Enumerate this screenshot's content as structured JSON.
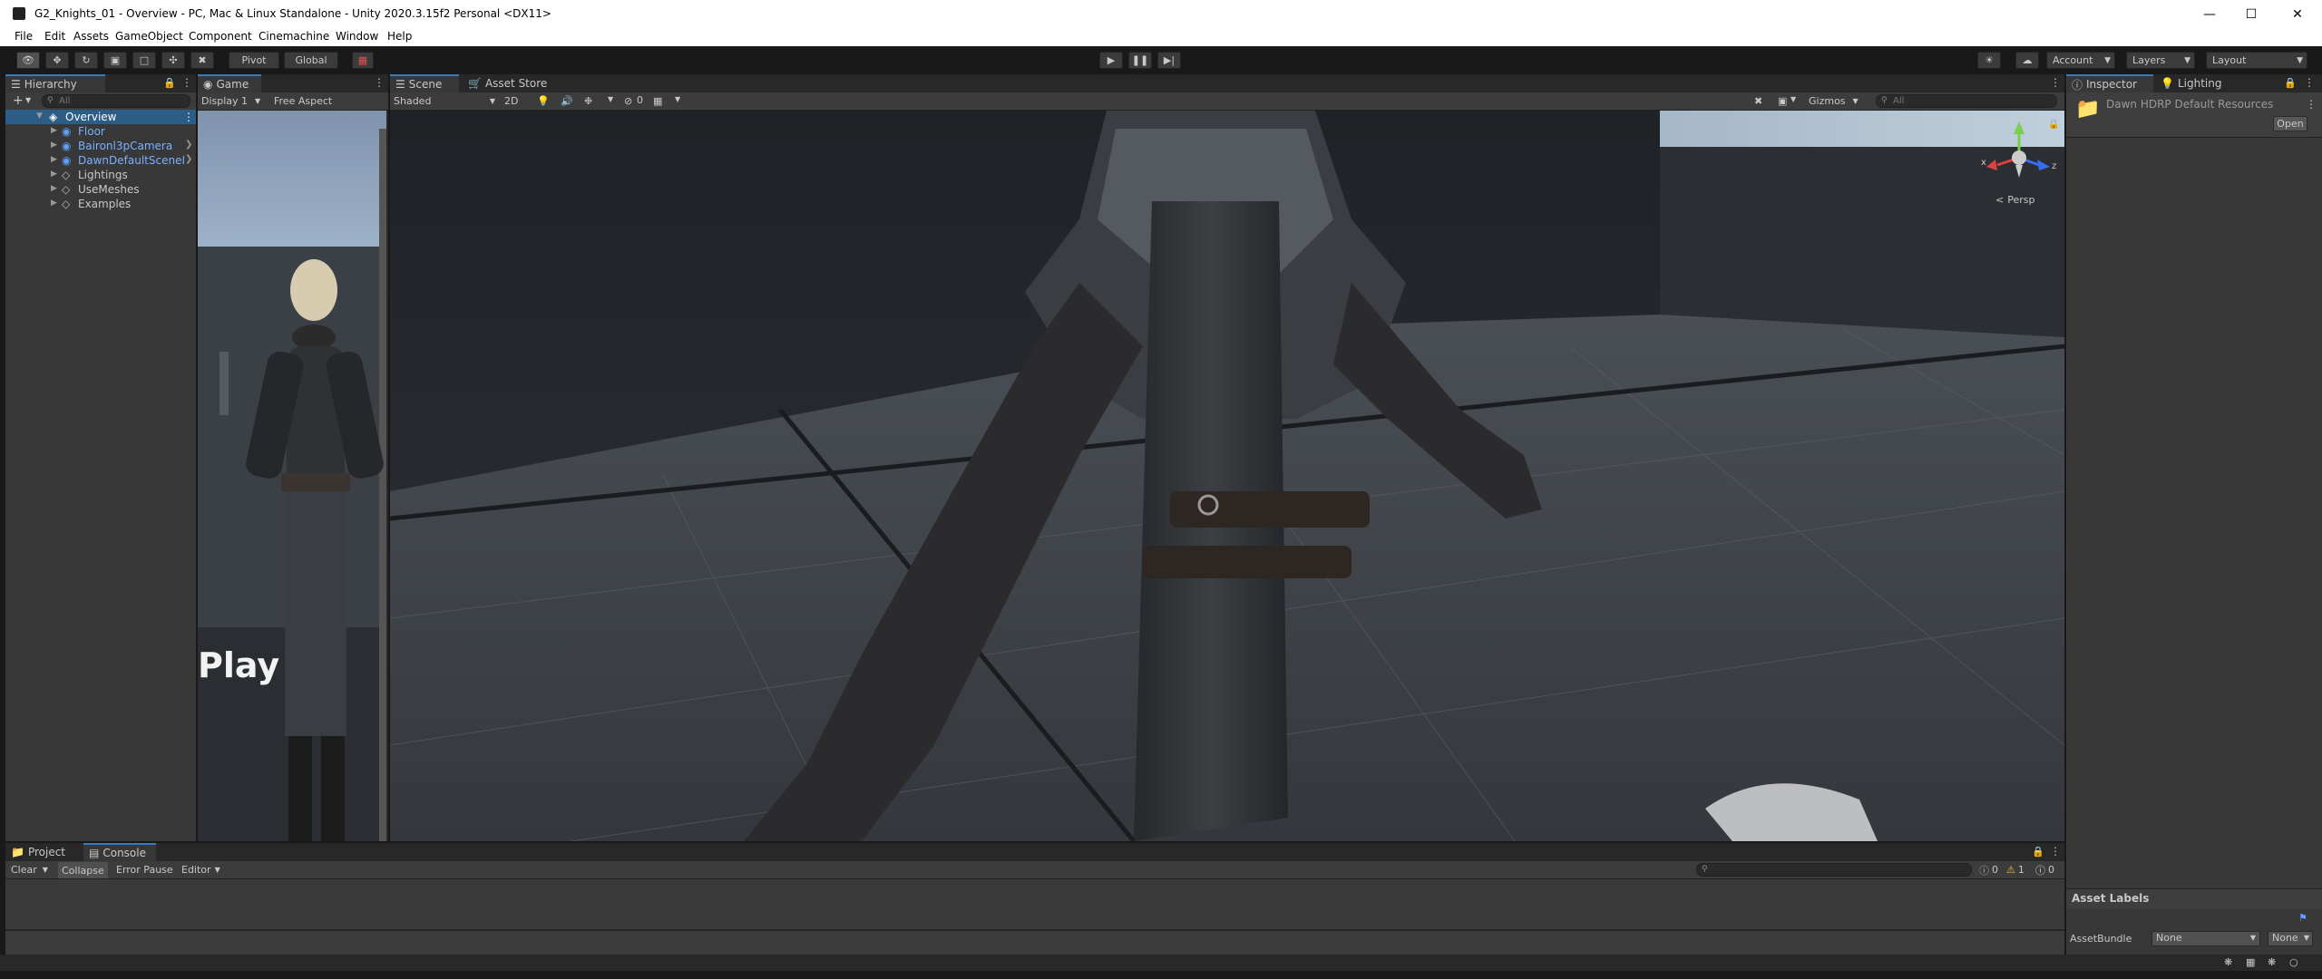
{
  "window": {
    "title": "G2_Knights_01 - Overview - PC, Mac & Linux Standalone - Unity 2020.3.15f2 Personal <DX11>",
    "controls": [
      "minimize-icon",
      "maximize-icon",
      "close-icon"
    ]
  },
  "menu": {
    "items": [
      "File",
      "Edit",
      "Assets",
      "GameObject",
      "Component",
      "Cinemachine",
      "Window",
      "Help"
    ]
  },
  "toolbar": {
    "pivot_label": "Pivot",
    "global_label": "Global",
    "account_label": "Account",
    "layers_label": "Layers",
    "layout_label": "Layout"
  },
  "hierarchy": {
    "tab_label": "Hierarchy",
    "add_label": "+",
    "search_placeholder": "All",
    "items": [
      {
        "label": "Overview"
      },
      {
        "label": "Floor"
      },
      {
        "label": "Baironl3pCamera"
      },
      {
        "label": "DawnDefaultSceneI"
      },
      {
        "label": "Lightings"
      },
      {
        "label": "UseMeshes"
      },
      {
        "label": "Examples"
      }
    ]
  },
  "game": {
    "tab_label": "Game",
    "display_label": "Display 1",
    "aspect_label": "Free Aspect",
    "overlay_text": "Play"
  },
  "scene": {
    "tabs": [
      "Scene",
      "Asset Store"
    ],
    "shading_label": "Shaded",
    "mode_2d_label": "2D",
    "hidden_count": "0",
    "gizmos_label": "Gizmos",
    "search_placeholder": "All",
    "persp_label": "Persp",
    "axis": {
      "x": "x",
      "y": "y",
      "z": "z"
    }
  },
  "inspector": {
    "tabs": [
      "Inspector",
      "Lighting"
    ],
    "asset_name": "Dawn HDRP Default Resources",
    "open_label": "Open",
    "asset_labels_header": "Asset Labels",
    "assetbundle_label": "AssetBundle",
    "assetbundle_value": "None",
    "variant_value": "None"
  },
  "bottom": {
    "tabs": [
      "Project",
      "Console"
    ],
    "clear_label": "Clear",
    "collapse_label": "Collapse",
    "error_pause_label": "Error Pause",
    "editor_label": "Editor",
    "info_count": "0",
    "warn_count": "1",
    "error_count": "0"
  },
  "colors": {
    "selection_blue": "#3a79bb",
    "prefab_blue": "#7bb0ff",
    "warning_yellow": "#f0c030",
    "panel_bg": "#383838",
    "scene_bg": "#2e3237"
  }
}
